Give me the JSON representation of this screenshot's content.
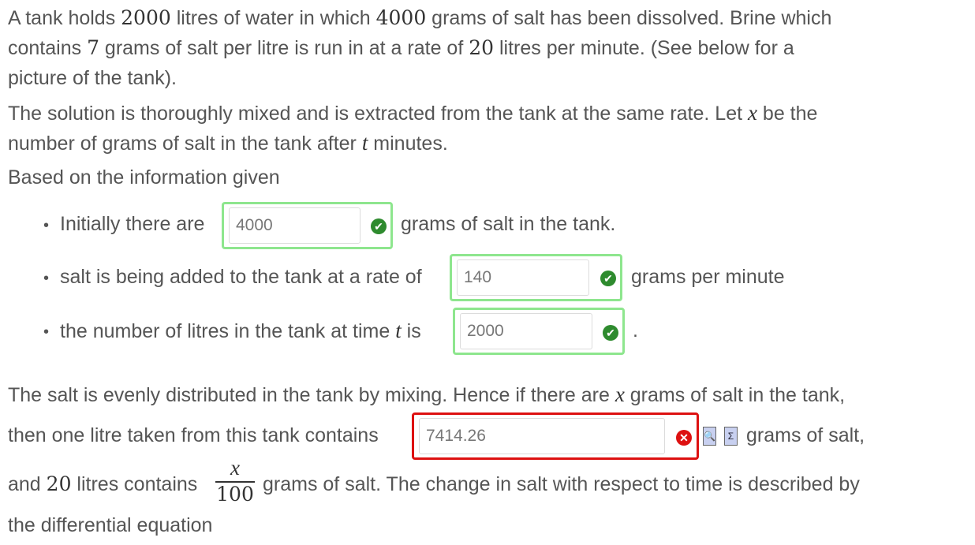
{
  "paragraph1": {
    "l1a": "A tank holds ",
    "v_tank": "2000",
    "l1b": " litres of water in which ",
    "v_salt": "4000",
    "l1c": " grams of salt has been dissolved. Brine which",
    "l2a": "contains ",
    "v_conc": "7",
    "l2b": " grams of salt per litre is run in at a rate of ",
    "v_rate": "20",
    "l2c": " litres per minute. (See below for a",
    "l3": "picture of the tank)."
  },
  "paragraph2": {
    "l1a": "The solution is thoroughly mixed and is extracted from the tank at the same rate. Let ",
    "var_x": "x",
    "l1b": " be the",
    "l2a": "number of grams of salt in the tank after ",
    "var_t": "t",
    "l2b": " minutes."
  },
  "paragraph3": "Based on the information given",
  "bullets": [
    {
      "before": "Initially there are",
      "value": "4000",
      "after": "grams of salt in the tank.",
      "status": "correct"
    },
    {
      "before": "salt is being added to the tank at a rate of",
      "value": "140",
      "after": "grams per minute",
      "status": "correct"
    },
    {
      "before_a": "the number of litres in the tank at time ",
      "var": "t",
      "before_b": " is",
      "value": "2000",
      "after": ".",
      "status": "correct"
    }
  ],
  "paragraph4": {
    "l1a": "The salt is evenly distributed in the tank by mixing. Hence if there are ",
    "var_x": "x",
    "l1b": " grams of salt in the tank,",
    "l2a": "then one litre taken from this tank contains",
    "answer": "7414.26",
    "answer_status": "incorrect",
    "l2b": "grams of salt,",
    "l3a": "and ",
    "v20": "20",
    "l3b": " litres contains",
    "frac_num": "x",
    "frac_den": "100",
    "l3c": "grams of salt. The change in salt with respect to time is described by",
    "l4": "the differential equation"
  },
  "colors": {
    "correct_border": "#8ee68e",
    "incorrect_border": "#dd1111",
    "tick": "#2e8b2e",
    "cross": "#dd1111"
  },
  "icons": {
    "correct": "check-circle-icon",
    "incorrect": "x-circle-icon",
    "preview": "preview-icon",
    "equation": "sigma-icon"
  }
}
